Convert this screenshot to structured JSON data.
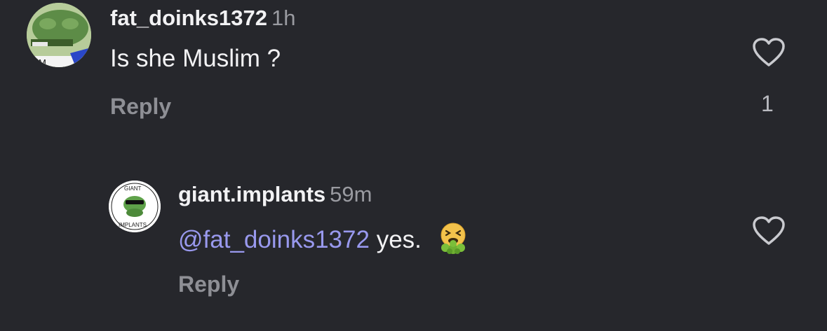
{
  "comments": [
    {
      "username": "fat_doinks1372",
      "time": "1h",
      "text": "Is she Muslim ?",
      "reply_label": "Reply",
      "like_count": "1",
      "avatar_text": "IUM"
    },
    {
      "username": "giant.implants",
      "time": "59m",
      "mention": "@fat_doinks1372",
      "text": "yes.",
      "emoji": "nauseated-vomiting-face",
      "reply_label": "Reply",
      "avatar_text_top": "GIANT",
      "avatar_text_bottom": "IMPLANTS"
    }
  ]
}
